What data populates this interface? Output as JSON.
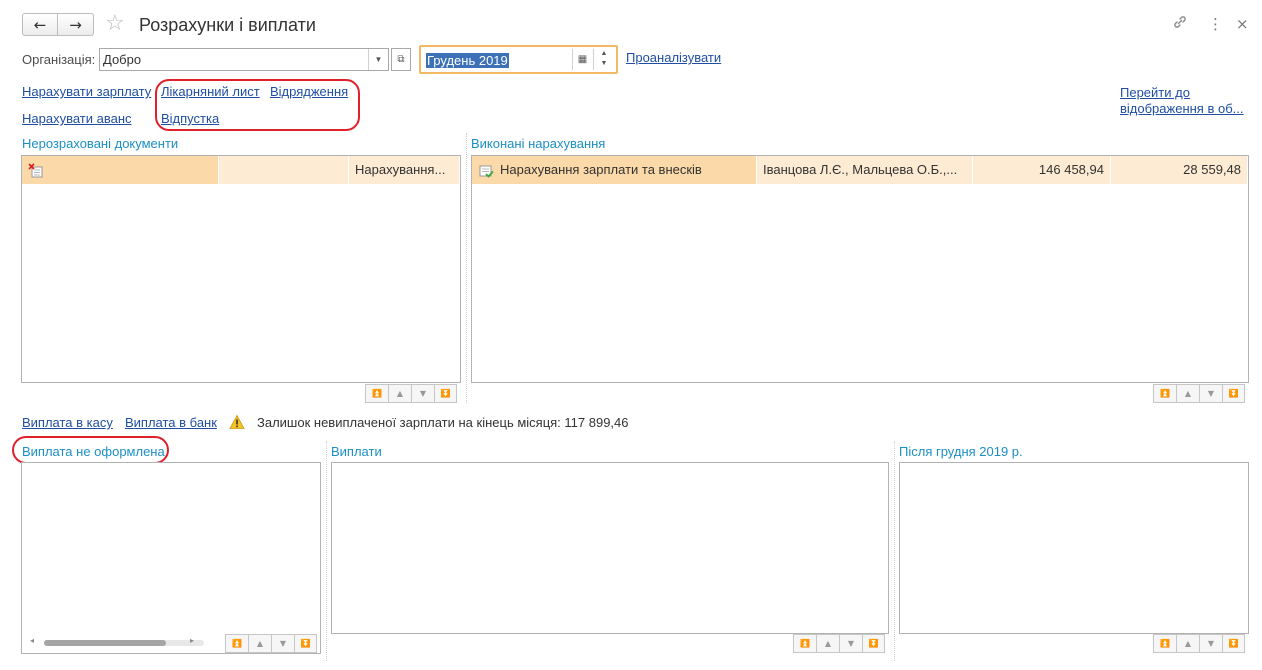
{
  "window": {
    "title": "Розрахунки і виплати",
    "back_icon": "←",
    "forward_icon": "→",
    "star_icon": "☆",
    "link_icon": "🔗",
    "more_icon": "⋮",
    "close_icon": "×"
  },
  "filters": {
    "organization_label": "Організація:",
    "organization_value": "Добро",
    "period_value": "Грудень 2019",
    "analyze_link": "Проаналізувати"
  },
  "actions": {
    "accrue_salary": "Нарахувати зарплату",
    "sick_leave": "Лікарняний лист",
    "business_trip": "Відрядження",
    "accrue_advance": "Нарахувати аванс",
    "vacation": "Відпустка",
    "switch_view": "Перейти до відображення в об..."
  },
  "unprocessed": {
    "title": "Нерозраховані документи",
    "rows": [
      {
        "col1": "",
        "col2": "",
        "col3": "Нарахування..."
      }
    ]
  },
  "completed": {
    "title": "Виконані нарахування",
    "rows": [
      {
        "document": "Нарахування зарплати та внесків",
        "employees": "Іванцова Л.Є., Мальцева О.Б.,...",
        "accrued": "146 458,94",
        "contributions": "28 559,48"
      }
    ]
  },
  "payments_actions": {
    "cash_payment": "Виплата в касу",
    "bank_payment": "Виплата в банк",
    "warning_text": "Залишок невиплаченої зарплати на кінець місяця: 117 899,46"
  },
  "bottom_panels": {
    "not_issued_title": "Виплата не оформлена",
    "payments_title": "Виплати",
    "after_title": "Після грудня 2019 р."
  },
  "colors": {
    "link": "#1f4ea3",
    "group_title": "#1b8fc6",
    "row_highlight": "#fbd9a9",
    "row_selected": "#fdebd3",
    "period_border": "#f3b866",
    "annotation": "#e0202a"
  }
}
